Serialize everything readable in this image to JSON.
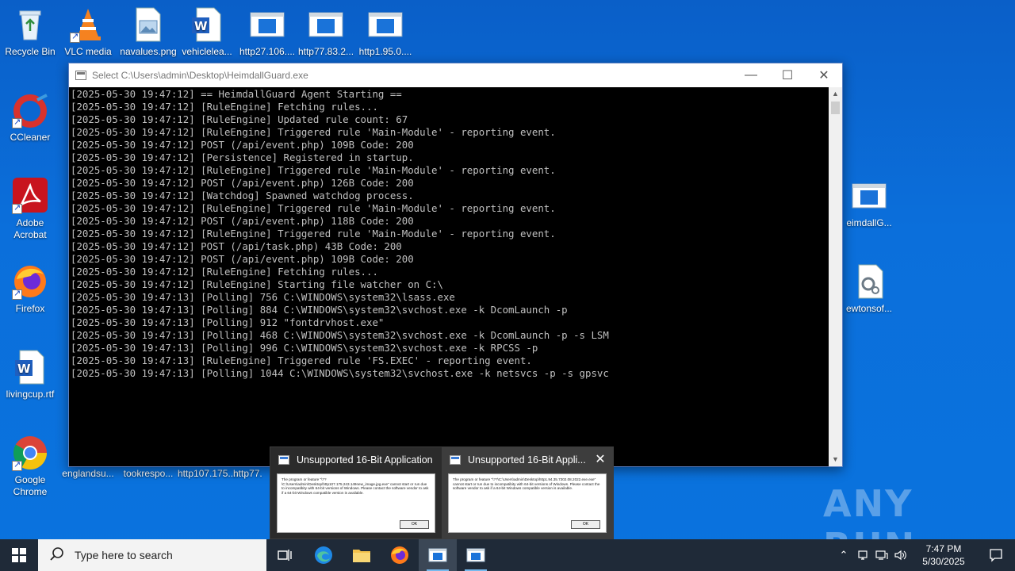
{
  "desktop": {
    "icons": [
      {
        "label": "Recycle Bin"
      },
      {
        "label": "VLC media"
      },
      {
        "label": "navalues.png"
      },
      {
        "label": "vehiclelea..."
      },
      {
        "label": "http27.106...."
      },
      {
        "label": "http77.83.2..."
      },
      {
        "label": "http1.95.0...."
      },
      {
        "label": "CCleaner"
      },
      {
        "label": "Adobe Acrobat"
      },
      {
        "label": "Firefox"
      },
      {
        "label": "livingcup.rtf"
      },
      {
        "label": "Google Chrome"
      },
      {
        "label": "englandsu..."
      },
      {
        "label": "tookrespo..."
      },
      {
        "label": "http107.175...."
      },
      {
        "label": "http77."
      },
      {
        "label": "eimdallG..."
      },
      {
        "label": "ewtonsof..."
      }
    ]
  },
  "console": {
    "title": "Select C:\\Users\\admin\\Desktop\\HeimdallGuard.exe",
    "lines": [
      "[2025-05-30 19:47:12] == HeimdallGuard Agent Starting ==",
      "[2025-05-30 19:47:12] [RuleEngine] Fetching rules...",
      "[2025-05-30 19:47:12] [RuleEngine] Updated rule count: 67",
      "[2025-05-30 19:47:12] [RuleEngine] Triggered rule 'Main-Module' - reporting event.",
      "[2025-05-30 19:47:12] POST (/api/event.php) 109B Code: 200",
      "[2025-05-30 19:47:12] [Persistence] Registered in startup.",
      "[2025-05-30 19:47:12] [RuleEngine] Triggered rule 'Main-Module' - reporting event.",
      "[2025-05-30 19:47:12] POST (/api/event.php) 126B Code: 200",
      "[2025-05-30 19:47:12] [Watchdog] Spawned watchdog process.",
      "[2025-05-30 19:47:12] [RuleEngine] Triggered rule 'Main-Module' - reporting event.",
      "[2025-05-30 19:47:12] POST (/api/event.php) 118B Code: 200",
      "[2025-05-30 19:47:12] [RuleEngine] Triggered rule 'Main-Module' - reporting event.",
      "[2025-05-30 19:47:12] POST (/api/task.php) 43B Code: 200",
      "[2025-05-30 19:47:12] POST (/api/event.php) 109B Code: 200",
      "[2025-05-30 19:47:12] [RuleEngine] Fetching rules...",
      "[2025-05-30 19:47:12] [RuleEngine] Starting file watcher on C:\\",
      "[2025-05-30 19:47:13] [Polling] 756 C:\\WINDOWS\\system32\\lsass.exe",
      "[2025-05-30 19:47:13] [Polling] 884 C:\\WINDOWS\\system32\\svchost.exe -k DcomLaunch -p",
      "[2025-05-30 19:47:13] [Polling] 912 \"fontdrvhost.exe\"",
      "[2025-05-30 19:47:13] [Polling] 468 C:\\WINDOWS\\system32\\svchost.exe -k DcomLaunch -p -s LSM",
      "[2025-05-30 19:47:13] [Polling] 996 C:\\WINDOWS\\system32\\svchost.exe -k RPCSS -p",
      "[2025-05-30 19:47:13] [RuleEngine] Triggered rule 'FS.EXEC' - reporting event.",
      "[2025-05-30 19:47:13] [Polling] 1044 C:\\WINDOWS\\system32\\svchost.exe -k netsvcs -p -s gpsvc"
    ]
  },
  "previews": [
    {
      "title": "Unsupported 16-Bit Application",
      "body": "The program or feature \"\\??\\C:\\Users\\admin\\Desktop\\http107.175.243.149new_image.jpg.exe\" cannot start or run due to incompatibity with 64-bit versions of Windows. Please contact the software vendor to ask if a 64-bit Windows compatible version is available.",
      "ok": "OK"
    },
    {
      "title": "Unsupported 16-Bit Appli...",
      "body": "The program or feature \"\\??\\C:\\Users\\admin\\Desktop\\http1.94.35.7302.08.2022.exe.exe\" cannot start or run due to incompatibity with 64-bit versions of Windows. Please contact the software vendor to ask if a 64-bit Windows compatible version is available.",
      "ok": "OK"
    }
  ],
  "watermark": "ANY RUN",
  "taskbar": {
    "search_placeholder": "Type here to search",
    "time": "7:47 PM",
    "date": "5/30/2025"
  },
  "colors": {
    "desktop_bg": "#0b6fdb",
    "taskbar_bg": "#1f2a38",
    "console_text": "#c0c0c0"
  }
}
